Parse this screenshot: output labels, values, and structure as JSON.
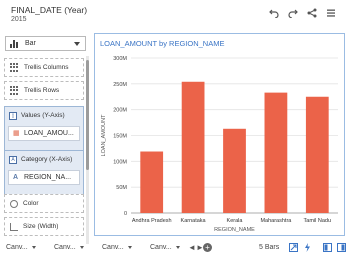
{
  "header": {
    "title": "FINAL_DATE (Year)",
    "subtitle": "2015",
    "icons": [
      "undo-icon",
      "redo-icon",
      "share-icon",
      "menu-icon"
    ]
  },
  "chart_type_select": {
    "value": "Bar"
  },
  "grammar_panel": {
    "trellis_columns": "Trellis Columns",
    "trellis_rows": "Trellis Rows",
    "values_label": "Values (Y-Axis)",
    "values_item": "LOAN_AMOU...",
    "category_label": "Category (X-Axis)",
    "category_item": "REGION_NA...",
    "color": "Color",
    "size": "Size (Width)"
  },
  "chart_data": {
    "type": "bar",
    "title": "LOAN_AMOUNT by REGION_NAME",
    "xlabel": "REGION_NAME",
    "ylabel": "LOAN_AMOUNT",
    "categories": [
      "Andhra Pradesh",
      "Karnataka",
      "Kerala",
      "Maharashtra",
      "Tamil Nadu"
    ],
    "values": [
      119,
      254,
      163,
      233,
      225
    ],
    "ylim": [
      0,
      300
    ],
    "yticks": [
      "0",
      "50M",
      "100M",
      "150M",
      "200M",
      "250M",
      "300M"
    ],
    "bar_color": "#eb6349",
    "grid": true
  },
  "footer": {
    "tabs": [
      "Canv...",
      "Canv...",
      "Canv...",
      "Canv...",
      "Canv..."
    ],
    "nav_prev": "◄",
    "nav_next": "►",
    "add_label": "+",
    "bar_count": "5 Bars"
  },
  "colors": {
    "accent": "#3a74c5",
    "bar": "#eb6349",
    "frame_border": "#9bbce3"
  }
}
